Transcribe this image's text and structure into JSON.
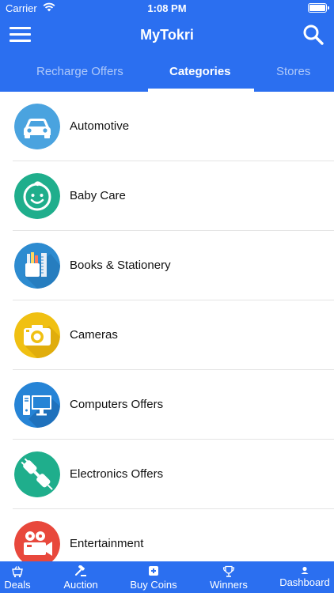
{
  "status_bar": {
    "carrier": "Carrier",
    "time": "1:08 PM"
  },
  "navbar": {
    "title": "MyTokri"
  },
  "tabs": [
    {
      "label": "Recharge Offers"
    },
    {
      "label": "Categories"
    },
    {
      "label": "Stores"
    }
  ],
  "categories": [
    {
      "label": "Automotive",
      "icon": "car-icon",
      "color": "#4aa3df"
    },
    {
      "label": "Baby Care",
      "icon": "baby-face-icon",
      "color": "#1fae8c"
    },
    {
      "label": "Books & Stationery",
      "icon": "books-stationery-icon",
      "color": "#2d8bd0"
    },
    {
      "label": "Cameras",
      "icon": "camera-icon",
      "color": "#f0c012"
    },
    {
      "label": "Computers Offers",
      "icon": "computer-icon",
      "color": "#2684d6"
    },
    {
      "label": "Electronics Offers",
      "icon": "plug-icon",
      "color": "#1fae8c"
    },
    {
      "label": "Entertainment",
      "icon": "movie-camera-icon",
      "color": "#e8483c"
    }
  ],
  "bottom_tabs": [
    {
      "label": "Deals",
      "icon": "basket-icon"
    },
    {
      "label": "Auction",
      "icon": "gavel-icon"
    },
    {
      "label": "Buy Coins",
      "icon": "plus-box-icon"
    },
    {
      "label": "Winners",
      "icon": "trophy-icon"
    },
    {
      "label": "Dashboard",
      "icon": "person-icon"
    }
  ],
  "colors": {
    "primary": "#2b6ff0",
    "divider": "#e4e4e4"
  }
}
